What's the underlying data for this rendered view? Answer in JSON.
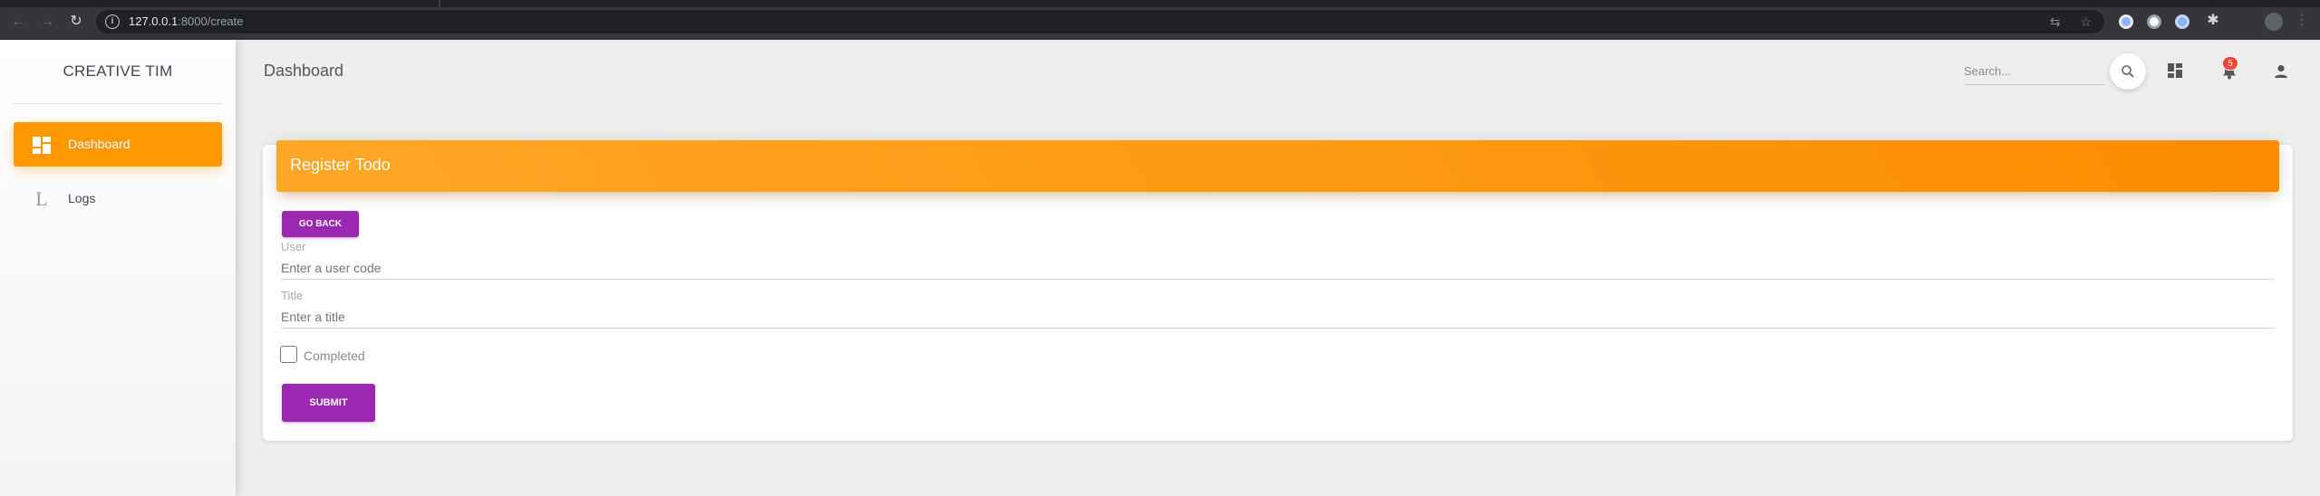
{
  "browser": {
    "url_host": "127.0.0.1",
    "url_path": ":8000/create"
  },
  "sidebar": {
    "brand": "CREATIVE TIM",
    "items": [
      {
        "label": "Dashboard",
        "icon": "dashboard-icon",
        "active": true
      },
      {
        "label": "Logs",
        "icon": "L",
        "active": false
      }
    ]
  },
  "navbar": {
    "title": "Dashboard",
    "search_placeholder": "Search...",
    "notification_count": "5"
  },
  "card": {
    "title": "Register Todo",
    "go_back_label": "Go back",
    "fields": [
      {
        "label": "User",
        "placeholder": "Enter a user code"
      },
      {
        "label": "Title",
        "placeholder": "Enter a title"
      }
    ],
    "checkbox_label": "Completed",
    "submit_label": "Submit"
  },
  "colors": {
    "accent_orange": "#ff9800",
    "button_purple": "#9c27b0",
    "badge_red": "#f44336"
  }
}
